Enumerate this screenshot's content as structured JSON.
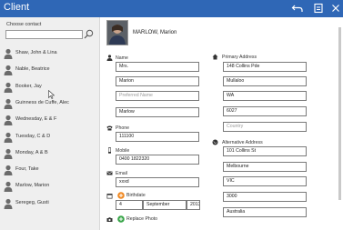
{
  "window": {
    "title": "Client"
  },
  "sidebar": {
    "heading": "Choose contact",
    "search_placeholder": "",
    "contacts": [
      "Shaw, John & Lina",
      "Nable, Beatrice",
      "Booker, Jay",
      "Guinness de Cuffe, Alec",
      "Wednesday, E & F",
      "Tuesday, C & D",
      "Monday, A & B",
      "Four, Take",
      "Marlow, Marion",
      "Seregeg, Gusti"
    ]
  },
  "detail": {
    "header_name": "MARLOW, Marion",
    "name": {
      "label": "Name",
      "title": "Mrs.",
      "first": "Marion",
      "preferred_placeholder": "Preferred Name",
      "last": "Marlow"
    },
    "phone": {
      "label": "Phone",
      "value": "111100"
    },
    "mobile": {
      "label": "Mobile",
      "value": "0400 1822320"
    },
    "email": {
      "label": "Email",
      "value": "xxxd"
    },
    "birthdate": {
      "label": "Birthdate",
      "day": "4",
      "month": "September",
      "year": "2013"
    },
    "replace_photo": "Replace Photo",
    "primary_address": {
      "label": "Primary Address",
      "street": "148 Collins Pde",
      "city": "Mullaloo",
      "state": "WA",
      "postcode": "6027",
      "country_placeholder": "Country"
    },
    "alternative_address": {
      "label": "Alternative Address",
      "street": "101 Collins St",
      "city": "Melbourne",
      "state": "VIC",
      "postcode": "3000",
      "country": "Australia"
    }
  },
  "icons": {
    "undo": "undo-icon",
    "save": "save-icon",
    "close": "close-icon",
    "search": "search-icon"
  },
  "colors": {
    "titlebar": "#2f67b6",
    "add_accent": "#f08a24",
    "replace_accent": "#3aa64a"
  }
}
